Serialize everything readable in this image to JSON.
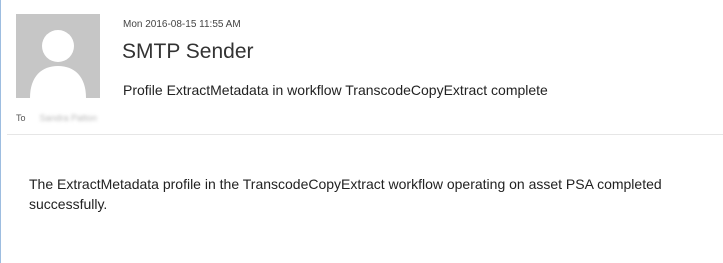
{
  "header": {
    "date": "Mon 2016-08-15 11:55 AM",
    "sender": "SMTP Sender",
    "subject": "Profile ExtractMetadata in workflow TranscodeCopyExtract complete",
    "to_label": "To",
    "to_recipient": "Sandra Patton"
  },
  "body": {
    "text": "The ExtractMetadata profile in the TranscodeCopyExtract workflow operating on asset PSA completed successfully."
  },
  "icons": {
    "avatar": "person-placeholder-icon"
  },
  "colors": {
    "avatar_bg": "#c6c6c6",
    "avatar_fg": "#ffffff",
    "accent_border": "#9dbde0"
  }
}
